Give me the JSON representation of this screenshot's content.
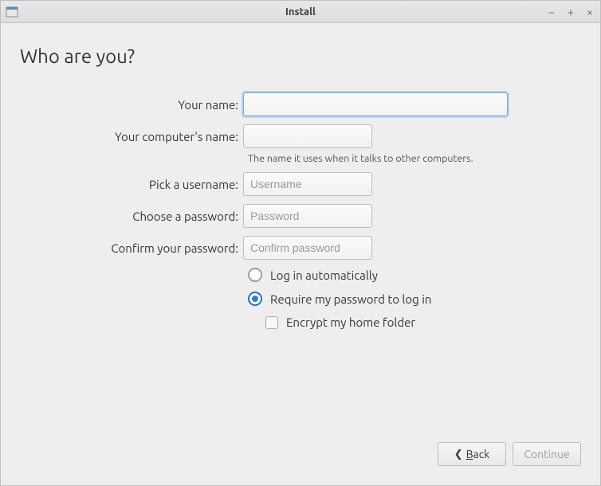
{
  "window": {
    "title": "Install"
  },
  "heading": "Who are you?",
  "form": {
    "name_label": "Your name:",
    "name_value": "",
    "computer_label": "Your computer's name:",
    "computer_value": "",
    "computer_help": "The name it uses when it talks to other computers.",
    "username_label": "Pick a username:",
    "username_placeholder": "Username",
    "username_value": "",
    "password_label": "Choose a password:",
    "password_placeholder": "Password",
    "password_value": "",
    "confirm_label": "Confirm your password:",
    "confirm_placeholder": "Confirm password",
    "confirm_value": ""
  },
  "options": {
    "auto_login": "Log in automatically",
    "require_password": "Require my password to log in",
    "encrypt_home": "Encrypt my home folder",
    "selected": "require_password",
    "encrypt_checked": false
  },
  "buttons": {
    "back": "Back",
    "continue": "Continue"
  }
}
